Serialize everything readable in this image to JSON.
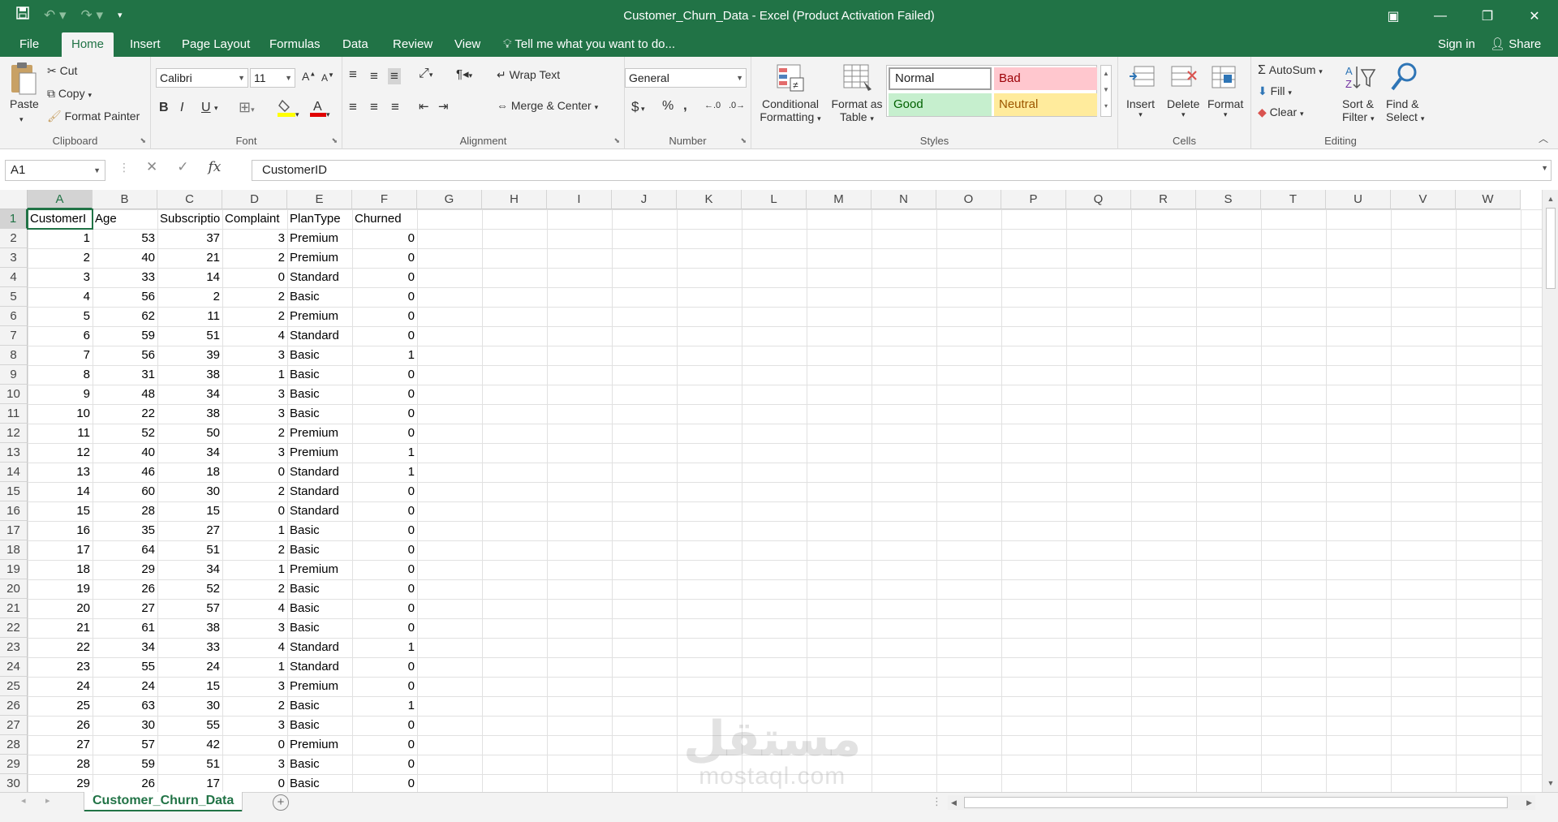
{
  "window": {
    "title": "Customer_Churn_Data - Excel (Product Activation Failed)",
    "qat": [
      "save-icon",
      "undo-icon",
      "redo-icon",
      "customize-icon"
    ],
    "controls": [
      "▣",
      "—",
      "❐",
      "✕"
    ]
  },
  "tabs": [
    "File",
    "Home",
    "Insert",
    "Page Layout",
    "Formulas",
    "Data",
    "Review",
    "View"
  ],
  "active_tab": "Home",
  "tell_me": "Tell me what you want to do...",
  "sign_in": "Sign in",
  "share": "Share",
  "ribbon": {
    "clipboard": {
      "label": "Clipboard",
      "paste": "Paste",
      "cut": "Cut",
      "copy": "Copy",
      "format_painter": "Format Painter"
    },
    "font": {
      "label": "Font",
      "name": "Calibri",
      "size": "11",
      "bold": "B",
      "italic": "I",
      "underline": "U"
    },
    "alignment": {
      "label": "Alignment",
      "wrap_text": "Wrap Text",
      "merge_center": "Merge & Center"
    },
    "number": {
      "label": "Number",
      "format": "General",
      "currency": "$",
      "percent": "%",
      "comma": ","
    },
    "styles": {
      "label": "Styles",
      "conditional": "Conditional",
      "formatting": "Formatting",
      "format_as": "Format as",
      "table": "Table",
      "normal": "Normal",
      "bad": "Bad",
      "good": "Good",
      "neutral": "Neutral"
    },
    "cells": {
      "label": "Cells",
      "insert": "Insert",
      "delete": "Delete",
      "format": "Format"
    },
    "editing": {
      "label": "Editing",
      "autosum": "AutoSum",
      "fill": "Fill",
      "clear": "Clear",
      "sort": "Sort &",
      "filter": "Filter",
      "find": "Find &",
      "select": "Select"
    }
  },
  "formula_bar": {
    "name_box": "A1",
    "content": "CustomerID",
    "fx": "fx"
  },
  "columns": [
    "A",
    "B",
    "C",
    "D",
    "E",
    "F",
    "G",
    "H",
    "I",
    "J",
    "K",
    "L",
    "M",
    "N",
    "O",
    "P",
    "Q",
    "R",
    "S",
    "T",
    "U",
    "V",
    "W"
  ],
  "headers": [
    "CustomerI",
    "Age",
    "Subscriptio",
    "Complaint",
    "PlanType",
    "Churned"
  ],
  "rows": [
    [
      1,
      53,
      37,
      3,
      "Premium",
      0
    ],
    [
      2,
      40,
      21,
      2,
      "Premium",
      0
    ],
    [
      3,
      33,
      14,
      0,
      "Standard",
      0
    ],
    [
      4,
      56,
      2,
      2,
      "Basic",
      0
    ],
    [
      5,
      62,
      11,
      2,
      "Premium",
      0
    ],
    [
      6,
      59,
      51,
      4,
      "Standard",
      0
    ],
    [
      7,
      56,
      39,
      3,
      "Basic",
      1
    ],
    [
      8,
      31,
      38,
      1,
      "Basic",
      0
    ],
    [
      9,
      48,
      34,
      3,
      "Basic",
      0
    ],
    [
      10,
      22,
      38,
      3,
      "Basic",
      0
    ],
    [
      11,
      52,
      50,
      2,
      "Premium",
      0
    ],
    [
      12,
      40,
      34,
      3,
      "Premium",
      1
    ],
    [
      13,
      46,
      18,
      0,
      "Standard",
      1
    ],
    [
      14,
      60,
      30,
      2,
      "Standard",
      0
    ],
    [
      15,
      28,
      15,
      0,
      "Standard",
      0
    ],
    [
      16,
      35,
      27,
      1,
      "Basic",
      0
    ],
    [
      17,
      64,
      51,
      2,
      "Basic",
      0
    ],
    [
      18,
      29,
      34,
      1,
      "Premium",
      0
    ],
    [
      19,
      26,
      52,
      2,
      "Basic",
      0
    ],
    [
      20,
      27,
      57,
      4,
      "Basic",
      0
    ],
    [
      21,
      61,
      38,
      3,
      "Basic",
      0
    ],
    [
      22,
      34,
      33,
      4,
      "Standard",
      1
    ],
    [
      23,
      55,
      24,
      1,
      "Standard",
      0
    ],
    [
      24,
      24,
      15,
      3,
      "Premium",
      0
    ],
    [
      25,
      63,
      30,
      2,
      "Basic",
      1
    ],
    [
      26,
      30,
      55,
      3,
      "Basic",
      0
    ],
    [
      27,
      57,
      42,
      0,
      "Premium",
      0
    ],
    [
      28,
      59,
      51,
      3,
      "Basic",
      0
    ],
    [
      29,
      26,
      17,
      0,
      "Basic",
      0
    ]
  ],
  "sheet_tab": "Customer_Churn_Data",
  "watermark": {
    "arabic": "مستقل",
    "latin": "mostaql.com"
  },
  "colors": {
    "accent": "#217346",
    "bad_bg": "#ffc7ce",
    "bad_fg": "#9c0006",
    "good_bg": "#c6efce",
    "good_fg": "#006100",
    "neutral_bg": "#ffeb9c",
    "neutral_fg": "#9c5700"
  }
}
